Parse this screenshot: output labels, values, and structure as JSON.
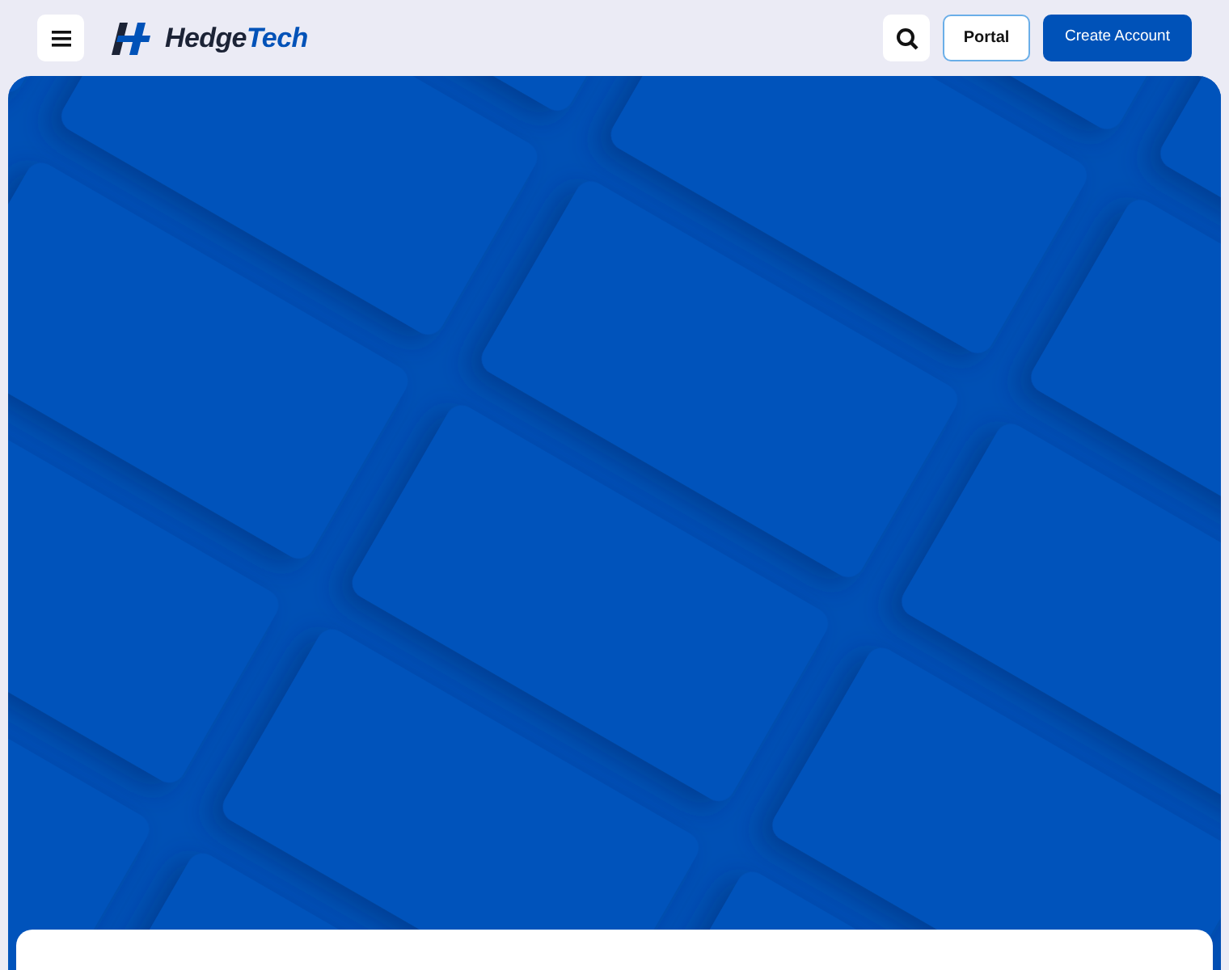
{
  "header": {
    "logo": {
      "primary": "Hedge",
      "accent": "Tech"
    },
    "buttons": [
      {
        "label": "Portal",
        "kind": "outline"
      },
      {
        "label": "Create Account",
        "kind": "solid"
      }
    ]
  }
}
